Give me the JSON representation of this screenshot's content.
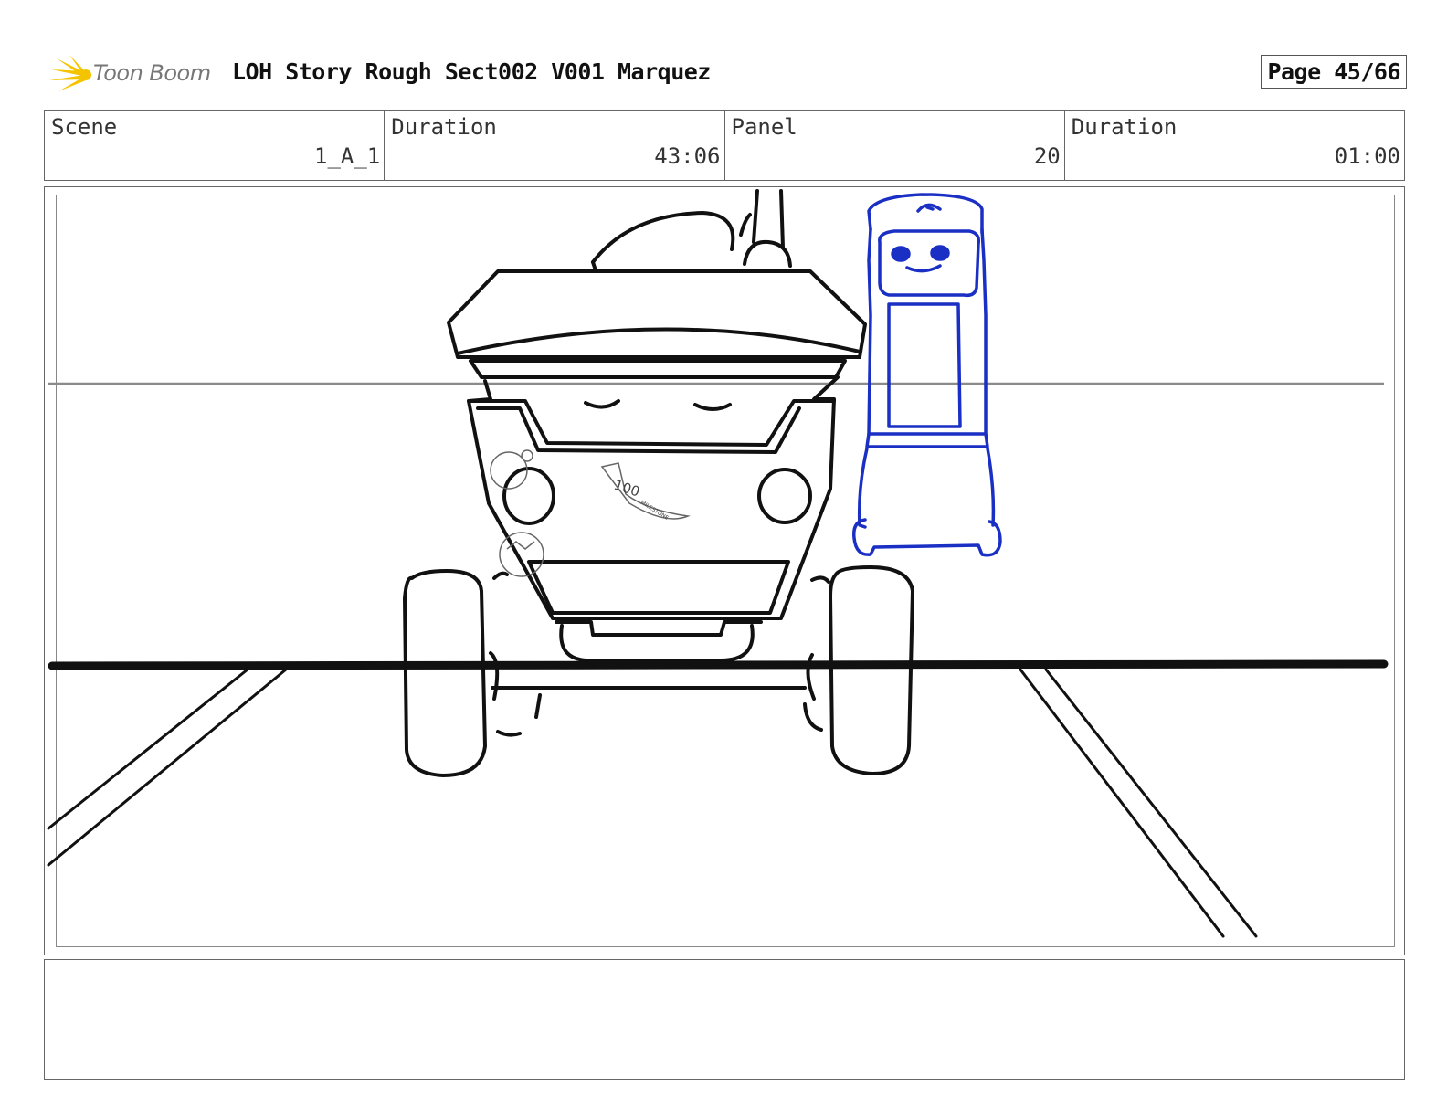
{
  "header": {
    "logo_text": "Toon Boom",
    "title": "LOH Story Rough Sect002 V001 Marquez",
    "page": "Page 45/66"
  },
  "info": {
    "scene_label": "Scene",
    "scene_value": "1_A_1",
    "duration_label": "Duration",
    "duration_value": "43:06",
    "panel_label": "Panel",
    "panel_value": "20",
    "panel_duration_label": "Duration",
    "panel_duration_value": "01:00"
  },
  "drawing": {
    "line_color": "#111111",
    "character_color": "#1a2fc4",
    "guide_color": "#8a8a8a",
    "logo_color": "#f5c400",
    "sticker_text": "100",
    "sticker_subtext": "MILESTONE"
  }
}
